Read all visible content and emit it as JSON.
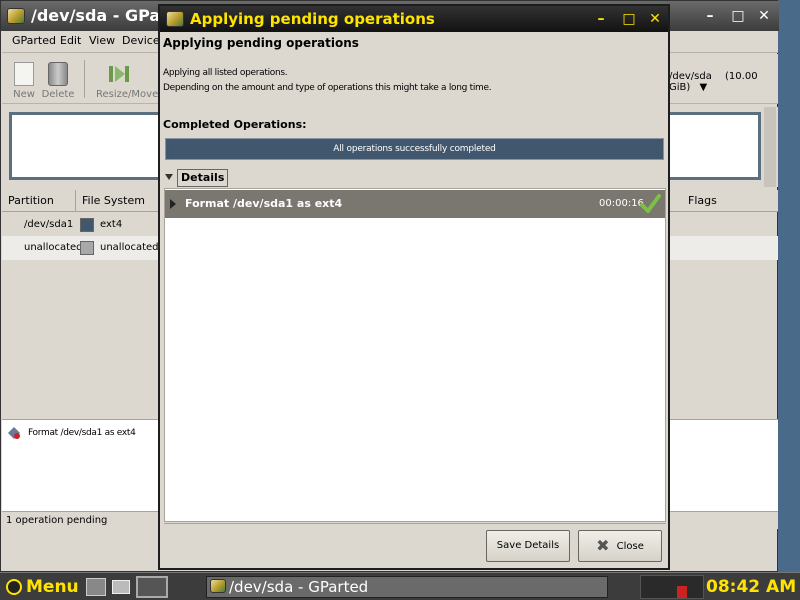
{
  "main_window": {
    "title": "/dev/sda - GParted",
    "menus": [
      "GParted",
      "Edit",
      "View",
      "Device"
    ],
    "toolbar": {
      "new": "New",
      "delete": "Delete",
      "resize_move": "Resize/Move"
    },
    "device": {
      "name": "/dev/sda",
      "size": "(10.00 GiB)"
    },
    "columns": {
      "partition": "Partition",
      "file_system": "File System",
      "flags": "Flags"
    },
    "rows": [
      {
        "partition": "/dev/sda1",
        "fs": "ext4",
        "color": "#41576e"
      },
      {
        "partition": "unallocated",
        "fs": "unallocated",
        "color": "#a8a8a8"
      }
    ],
    "pending_op": "Format /dev/sda1 as ext4",
    "status": "1 operation pending"
  },
  "dialog": {
    "title": "Applying pending operations",
    "heading": "Applying pending operations",
    "desc1": "Applying all listed operations.",
    "desc2": "Depending on the amount and type of operations this might take a long time.",
    "completed_label": "Completed Operations:",
    "progress_text": "All operations successfully completed",
    "progress": 1.0,
    "details_label": "Details",
    "operation": {
      "label": "Format /dev/sda1 as ext4",
      "time": "00:00:16",
      "status": "success"
    },
    "save_button": "Save Details",
    "close_button": "Close"
  },
  "taskbar": {
    "menu": "Menu",
    "task": "/dev/sda - GParted",
    "clock": "08:42 AM"
  },
  "colors": {
    "accent": "#ffe400",
    "progress": "#41576e",
    "check": "#7cc242"
  }
}
